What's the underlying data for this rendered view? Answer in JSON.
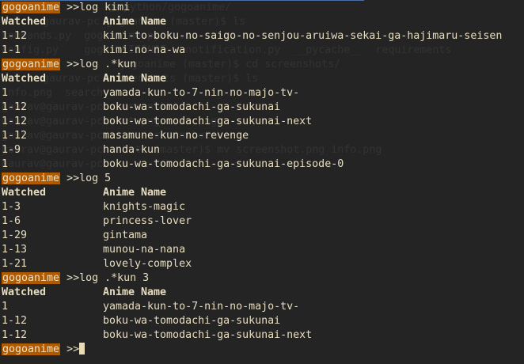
{
  "prompt_label": "gogoanime",
  "prompt_symbol": ">>",
  "header": {
    "watched": "Watched",
    "anime_name": "Anime Name"
  },
  "colors": {
    "background": "#242424",
    "text": "#e6dcc0",
    "prompt_bg": "#b05a00"
  },
  "commands": [
    {
      "command": "log kimi",
      "rows": [
        {
          "watched": "1-12",
          "name": "kimi-to-boku-no-saigo-no-senjou-aruiwa-sekai-ga-hajimaru-seisen"
        },
        {
          "watched": "1-1",
          "name": "kimi-no-na-wa"
        }
      ]
    },
    {
      "command": "log .*kun",
      "rows": [
        {
          "watched": "1",
          "name": "yamada-kun-to-7-nin-no-majo-tv-"
        },
        {
          "watched": "1-12",
          "name": "boku-wa-tomodachi-ga-sukunai"
        },
        {
          "watched": "1-12",
          "name": "boku-wa-tomodachi-ga-sukunai-next"
        },
        {
          "watched": "1-12",
          "name": "masamune-kun-no-revenge"
        },
        {
          "watched": "1-9",
          "name": "handa-kun"
        },
        {
          "watched": "1",
          "name": "boku-wa-tomodachi-ga-sukunai-episode-0"
        }
      ]
    },
    {
      "command": "log 5",
      "rows": [
        {
          "watched": "1-3",
          "name": "knights-magic"
        },
        {
          "watched": "1-6",
          "name": "princess-lover"
        },
        {
          "watched": "1-29",
          "name": "gintama"
        },
        {
          "watched": "1-13",
          "name": "munou-na-nana"
        },
        {
          "watched": "1-21",
          "name": "lovely-complex"
        }
      ]
    },
    {
      "command": "log .*kun 3",
      "rows": [
        {
          "watched": "1",
          "name": "yamada-kun-to-7-nin-no-majo-tv-"
        },
        {
          "watched": "1-12",
          "name": "boku-wa-tomodachi-ga-sukunai"
        },
        {
          "watched": "1-12",
          "name": "boku-wa-tomodachi-ga-sukunai-next"
        }
      ]
    }
  ],
  "background_ghost": [
    "cd python/gogoanime/",
    "gaurav-pc gogoanime (master)$ ls",
    "commands.py  gogoanime.py  ...",
    "config.py    gogo  LICENSE   notification.py  __pycache__  requirements",
    "gogoanime (master)$ cd screenshots/",
    "gaurav-pc screenshots (master)$ ls",
    "info.png  search",
    "gaurav@gaurav-pc  screenshot",
    "gaurav@gaurav-pc  hot.png info.png",
    "gaurav@gaurav-pc  save-screenshot",
    "gaurav@gaurav-pc  shots (master)$ mv screenshot.png info.png",
    "gaurav@gaurav-pc"
  ]
}
